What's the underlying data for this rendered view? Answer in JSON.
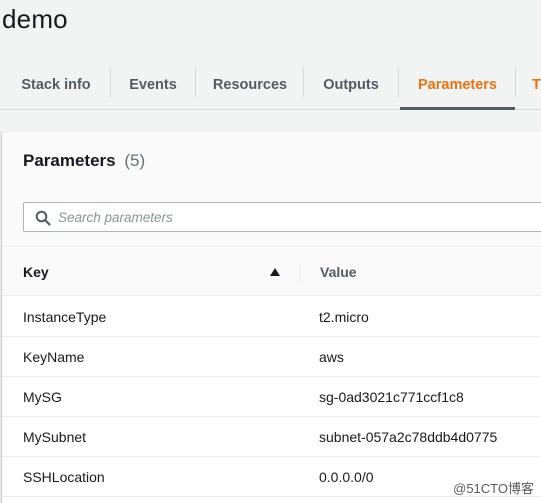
{
  "stack": {
    "title": "demo"
  },
  "tabs": [
    {
      "label": "Stack info",
      "active": false
    },
    {
      "label": "Events",
      "active": false
    },
    {
      "label": "Resources",
      "active": false
    },
    {
      "label": "Outputs",
      "active": false
    },
    {
      "label": "Parameters",
      "active": true
    },
    {
      "label": "T",
      "active": false
    }
  ],
  "parameters": {
    "title": "Parameters",
    "count": "(5)",
    "search_placeholder": "Search parameters",
    "columns": {
      "key": "Key",
      "value": "Value"
    },
    "rows": [
      {
        "key": "InstanceType",
        "value": "t2.micro"
      },
      {
        "key": "KeyName",
        "value": "aws"
      },
      {
        "key": "MySG",
        "value": "sg-0ad3021c771ccf1c8"
      },
      {
        "key": "MySubnet",
        "value": "subnet-057a2c78ddb4d0775"
      },
      {
        "key": "SSHLocation",
        "value": "0.0.0.0/0"
      }
    ]
  },
  "colors": {
    "active_tab": "#ec7211",
    "text": "#16191f",
    "muted": "#545b64"
  },
  "icons": {
    "search": "search-icon",
    "sort": "sort-ascending-icon"
  },
  "watermark": {
    "text": "@51CTO博客"
  }
}
